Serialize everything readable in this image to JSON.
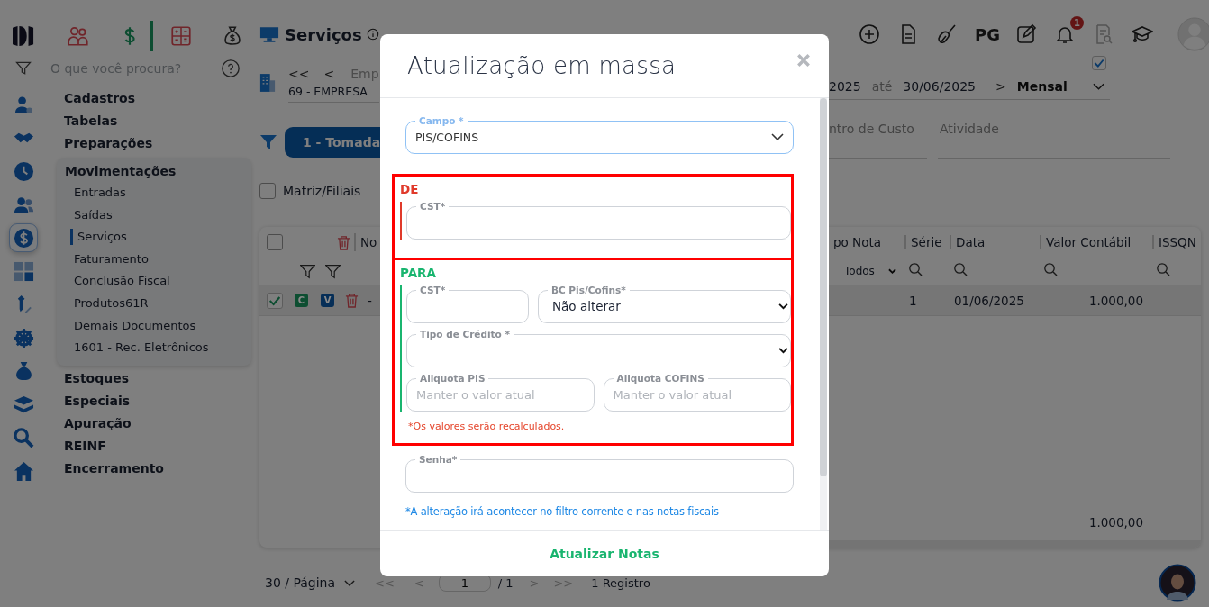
{
  "app": {
    "module_tabs": [
      {
        "kind": "people",
        "selected": false
      },
      {
        "kind": "dollar",
        "selected": true
      },
      {
        "kind": "calculator",
        "selected": false
      },
      {
        "kind": "money-bag",
        "selected": false
      }
    ]
  },
  "sidebar": {
    "search_placeholder": "O que você procura?",
    "rail": [
      {
        "kind": "user-gear",
        "selected": false
      },
      {
        "kind": "handshake",
        "selected": false
      },
      {
        "kind": "clock",
        "selected": false
      },
      {
        "kind": "users",
        "selected": false
      },
      {
        "kind": "dollar",
        "selected": true
      },
      {
        "kind": "calculator",
        "selected": false
      },
      {
        "kind": "pen",
        "selected": false
      },
      {
        "kind": "gear",
        "selected": false
      },
      {
        "kind": "money-bag",
        "selected": false
      },
      {
        "kind": "layers",
        "selected": false
      },
      {
        "kind": "search",
        "selected": false
      },
      {
        "kind": "home",
        "selected": false
      }
    ],
    "menu": [
      {
        "label": "Cadastros",
        "expanded": false
      },
      {
        "label": "Tabelas",
        "expanded": false
      },
      {
        "label": "Preparações",
        "expanded": false
      },
      {
        "label": "Movimentações",
        "expanded": true,
        "children": [
          {
            "label": "Entradas",
            "selected": false
          },
          {
            "label": "Saídas",
            "selected": false
          },
          {
            "label": "Serviços",
            "selected": true
          },
          {
            "label": "Faturamento",
            "selected": false
          },
          {
            "label": "Conclusão Fiscal",
            "selected": false
          },
          {
            "label": "Produtos61R",
            "selected": false
          },
          {
            "label": "Demais Documentos",
            "selected": false
          },
          {
            "label": "1601 - Rec. Eletrônicos",
            "selected": false
          }
        ]
      },
      {
        "label": "Estoques",
        "expanded": false
      },
      {
        "label": "Especiais",
        "expanded": false
      },
      {
        "label": "Apuração",
        "expanded": false
      },
      {
        "label": "REINF",
        "expanded": false
      },
      {
        "label": "Encerramento",
        "expanded": false
      }
    ]
  },
  "page": {
    "title": "Serviços",
    "toolbar": [
      {
        "kind": "plus"
      },
      {
        "kind": "document"
      },
      {
        "kind": "broom"
      },
      {
        "kind": "text",
        "label": "PG"
      },
      {
        "kind": "edit"
      },
      {
        "kind": "bell",
        "badge": "1"
      },
      {
        "kind": "search-doc",
        "disabled": true
      },
      {
        "kind": "cap"
      }
    ],
    "company": {
      "nav": [
        "<<",
        "<"
      ],
      "label": "Emp",
      "name": "69 - EMPRESA"
    },
    "period": {
      "checked": true,
      "from": "2025",
      "to_label": "até",
      "to": "30/06/2025",
      "next": ">",
      "mode": "Mensal"
    },
    "filter_button": "1 - Tomada",
    "filter_tabs": [
      "ntro de Custo",
      "Atividade"
    ],
    "matriz": {
      "label": "Matriz/Filiais",
      "checked": false
    }
  },
  "table": {
    "select_all_checked": false,
    "left_header": "No",
    "columns": [
      "po Nota",
      "Série",
      "Data",
      "Valor Contábil",
      "ISSQN"
    ],
    "type_filter": "Todos",
    "rows": [
      {
        "checked": true,
        "badges": [
          {
            "label": "C",
            "color": "#0d4e31"
          },
          {
            "label": "V",
            "color": "#062e57"
          }
        ],
        "cell_left": "-",
        "serie": "1",
        "data": "01/06/2025",
        "valor": "1.000,00"
      }
    ],
    "total": "1.000,00"
  },
  "pagination": {
    "page_size": "30 / Página",
    "first": "<<",
    "prev": "<",
    "page": "1",
    "of": "/ 1",
    "next": ">",
    "last": ">>",
    "count": "1 Registro"
  },
  "modal": {
    "title": "Atualização em massa",
    "campo": {
      "label": "Campo *",
      "value": "PIS/COFINS"
    },
    "de": {
      "title": "DE",
      "highlighted": true,
      "cst_label": "CST*"
    },
    "para": {
      "title": "PARA",
      "highlighted": true,
      "cst_label": "CST*",
      "bc": {
        "label": "BC Pis/Cofins*",
        "value": "Não alterar"
      },
      "tipo_credito": {
        "label": "Tipo de Crédito *"
      },
      "aliquota_pis": {
        "label": "Aliquota PIS",
        "placeholder": "Manter o valor atual"
      },
      "aliquota_cofins": {
        "label": "Aliquota COFINS",
        "placeholder": "Manter o valor atual"
      },
      "note": "*Os valores serão recalculados."
    },
    "senha": {
      "label": "Senha*"
    },
    "info": "*A alteração irá acontecer no filtro corrente e nas notas fiscais",
    "submit": "Atualizar Notas"
  }
}
